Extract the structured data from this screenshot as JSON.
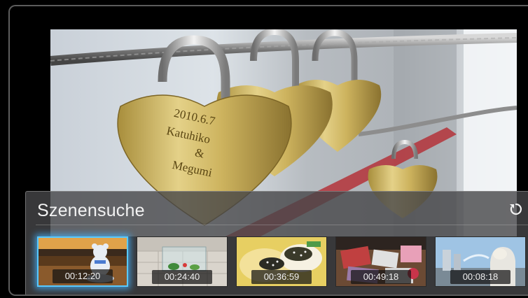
{
  "panel": {
    "title": "Szenensuche",
    "refresh_icon": "refresh-icon"
  },
  "scenes": [
    {
      "time": "00:12:20",
      "selected": true,
      "scene": "teddy-bear-figure"
    },
    {
      "time": "00:24:40",
      "selected": false,
      "scene": "glass-terrarium"
    },
    {
      "time": "00:36:59",
      "selected": false,
      "scene": "sushi-dish"
    },
    {
      "time": "00:49:18",
      "selected": false,
      "scene": "shoes-market"
    },
    {
      "time": "00:08:18",
      "selected": false,
      "scene": "merlion-statue"
    }
  ],
  "video_frame": {
    "lock_engraving": [
      "2010.6.7",
      "Katuhiko",
      "&",
      "Megumi"
    ]
  },
  "colors": {
    "accent": "#58c9ff",
    "panel_bg": "#464648",
    "text": "#f2f2f2"
  }
}
